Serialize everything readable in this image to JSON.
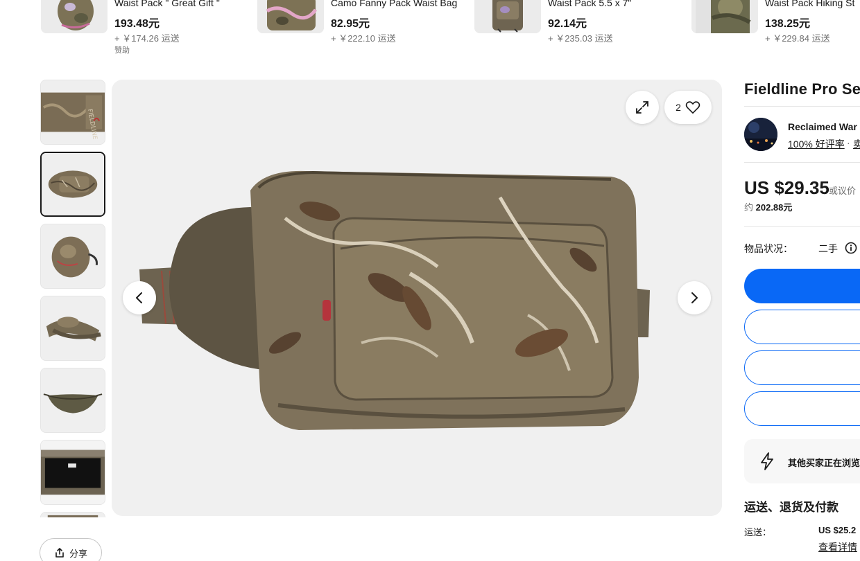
{
  "carousel": {
    "items": [
      {
        "title": "Waist Pack \" Great Gift \"",
        "price": "193.48元",
        "shipping": "+ ￥174.26 运送",
        "sponsored": "赞助"
      },
      {
        "title": "Camo Fanny Pack Waist Bag",
        "price": "82.95元",
        "shipping": "+ ￥222.10 运送"
      },
      {
        "title": "Waist Pack 5.5 x 7\"",
        "price": "92.14元",
        "shipping": "+ ￥235.03 运送"
      },
      {
        "title": "Waist Pack Hiking St",
        "price": "138.25元",
        "shipping": "+ ￥229.84 运送"
      }
    ]
  },
  "gallery": {
    "thumbnail_count": 7,
    "active_index": 1,
    "like_count": "2"
  },
  "actions": {
    "share_label": "分享"
  },
  "item": {
    "title": "Fieldline Pro Se",
    "seller_name": "Reclaimed War",
    "seller_rating": "100% 好评率",
    "seller_sep": "·",
    "seller_more": "卖",
    "price": "US $29.35",
    "price_or": "或议价",
    "price_approx_prefix": "约 ",
    "price_approx_value": "202.88元",
    "condition_label": "物品状况：",
    "condition_value": "二手",
    "notice": "其他买家正在浏览",
    "shipping_section": "运送、退货及付款",
    "shipping_label": "运送：",
    "shipping_value": "US $25.2",
    "shipping_details": "查看详情"
  },
  "colors": {
    "accent": "#0968f6",
    "text": "#191919",
    "muted": "#707070"
  }
}
